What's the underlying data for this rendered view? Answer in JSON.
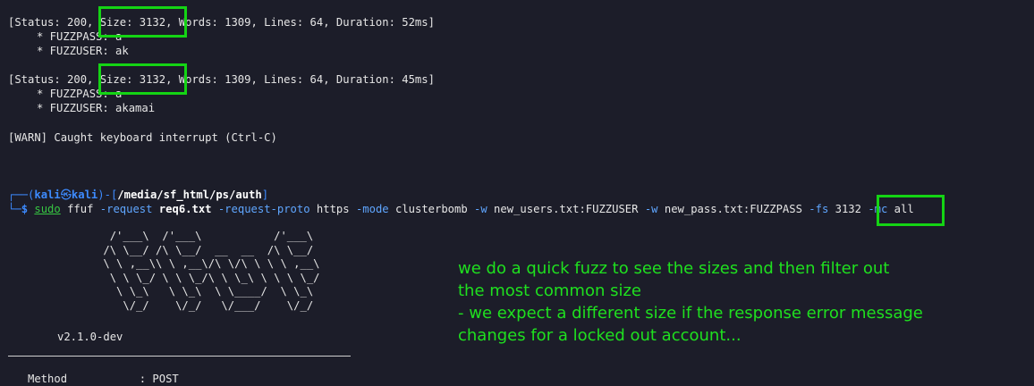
{
  "terminal": {
    "result1": {
      "status_line": "[Status: 200, Size: 3132, Words: 1309, Lines: 64, Duration: 52ms]",
      "pass_line": "* FUZZPASS: a",
      "user_line": "* FUZZUSER: ak"
    },
    "result2": {
      "status_line": "[Status: 200, Size: 3132, Words: 1309, Lines: 64, Duration: 45ms]",
      "pass_line": "* FUZZPASS: a",
      "user_line": "* FUZZUSER: akamai"
    },
    "warn_line": "[WARN] Caught keyboard interrupt (Ctrl-C)",
    "prompt": {
      "corner_top": "┌──(",
      "user": "kali",
      "at": "㉿",
      "host": "kali",
      "mid": ")-[",
      "path": "/media/sf_html/ps/auth",
      "end": "]",
      "corner_bottom": "└─",
      "symbol": "$"
    },
    "command": {
      "sudo": "sudo",
      "prog": " ffuf ",
      "flag_request": "-request",
      "file": " req6.txt ",
      "flag_proto": "-request-proto",
      "proto": " https ",
      "flag_mode": "-mode",
      "mode": " clusterbomb ",
      "flag_w1": "-w",
      "w1": " new_users.txt:FUZZUSER ",
      "flag_w2": "-w",
      "w2": " new_pass.txt:FUZZPASS ",
      "flag_fs": "-fs",
      "fs": " 3132 ",
      "flag_mc": "-mc",
      "mc": " all"
    },
    "banner": "        /'___\\  /'___\\           /'___\\\n       /\\ \\__/ /\\ \\__/  __  __  /\\ \\__/\n       \\ \\ ,__\\\\ \\ ,__\\/\\ \\/\\ \\ \\ \\ ,__\\\n        \\ \\ \\_/ \\ \\ \\_/\\ \\ \\_\\ \\ \\ \\ \\_/\n         \\ \\_\\   \\ \\_\\  \\ \\____/  \\ \\_\\\n          \\/_/    \\/_/   \\/___/    \\/_/",
    "version": "v2.1.0-dev",
    "cut_line": "   Method           : POST"
  },
  "annotation": {
    "lines": [
      "we do a quick fuzz to see the sizes and then filter out",
      "the most common size",
      "- we expect a different size if the response error message",
      "changes for a locked out account..."
    ],
    "color": "#1fe01f"
  }
}
